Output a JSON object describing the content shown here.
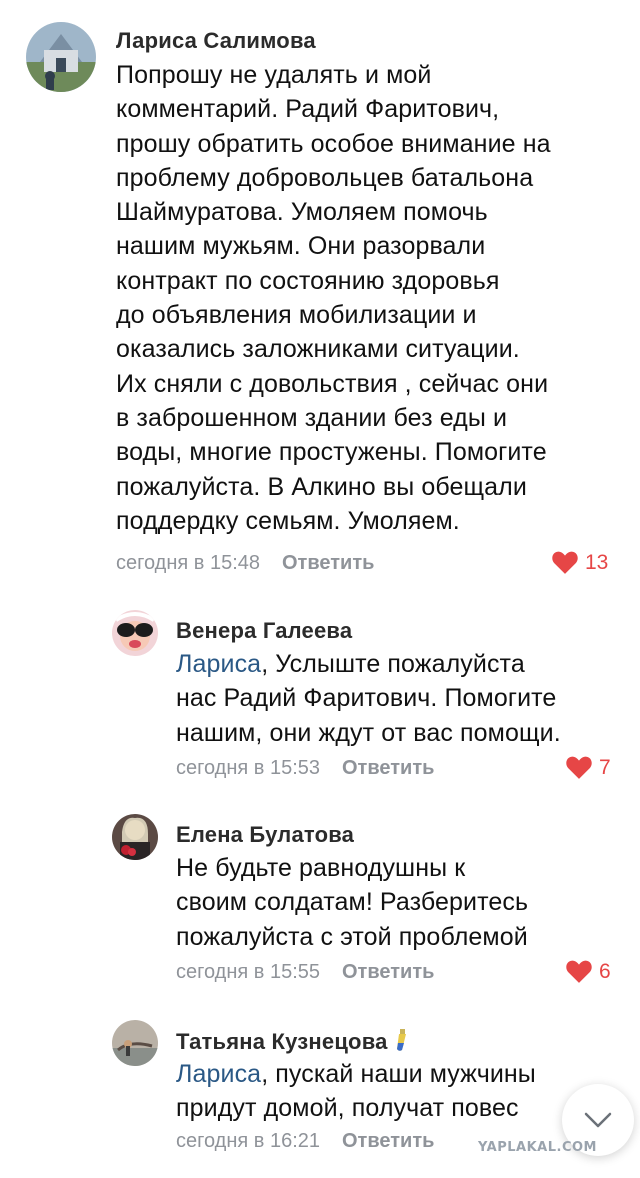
{
  "comments": [
    {
      "author": "Лариса Салимова",
      "text": "Попрошу не удалять и мой\nкомментарий. Радий Фаритович,\nпрошу обратить особое внимание на\nпроблему добровольцев батальона\nШаймуратова. Умоляем помочь\nнашим мужьям. Они разорвали\nконтракт по состоянию здоровья\nдо объявления мобилизации и\nоказались заложниками ситуации.\nИх сняли с довольствия , сейчас они\nв заброшенном здании без еды и\nводы, многие простужены. Помогите\nпожалуйста. В Алкино вы обещали\nподдердку семьям. Умоляем.",
      "time": "сегодня в 15:48",
      "reply_label": "Ответить",
      "likes": "13"
    },
    {
      "author": "Венера Галеева",
      "mention": "Лариса",
      "text": ", Услыште пожалуйста\nнас Радий Фаритович. Помогите\nнашим, они ждут от вас помощи.",
      "time": "сегодня в 15:53",
      "reply_label": "Ответить",
      "likes": "7"
    },
    {
      "author": "Елена Булатова",
      "text": "Не будьте равнодушны к\nсвоим солдатам! Разберитесь\nпожалуйста с этой проблемой",
      "time": "сегодня в 15:55",
      "reply_label": "Ответить",
      "likes": "6"
    },
    {
      "author": "Татьяна Кузнецова",
      "mention": "Лариса",
      "text": ", пускай наши мужчины\nпридут домой, получат повес",
      "time": "сегодня в 16:21",
      "reply_label": "Ответить"
    }
  ],
  "watermark": "YAPLAKAL.COM",
  "colors": {
    "like": "#e64646",
    "mention": "#2a5885",
    "meta": "#8f9399"
  },
  "icons": [
    "heart-icon",
    "chevron-down-icon",
    "test-tube-emoji-icon"
  ]
}
